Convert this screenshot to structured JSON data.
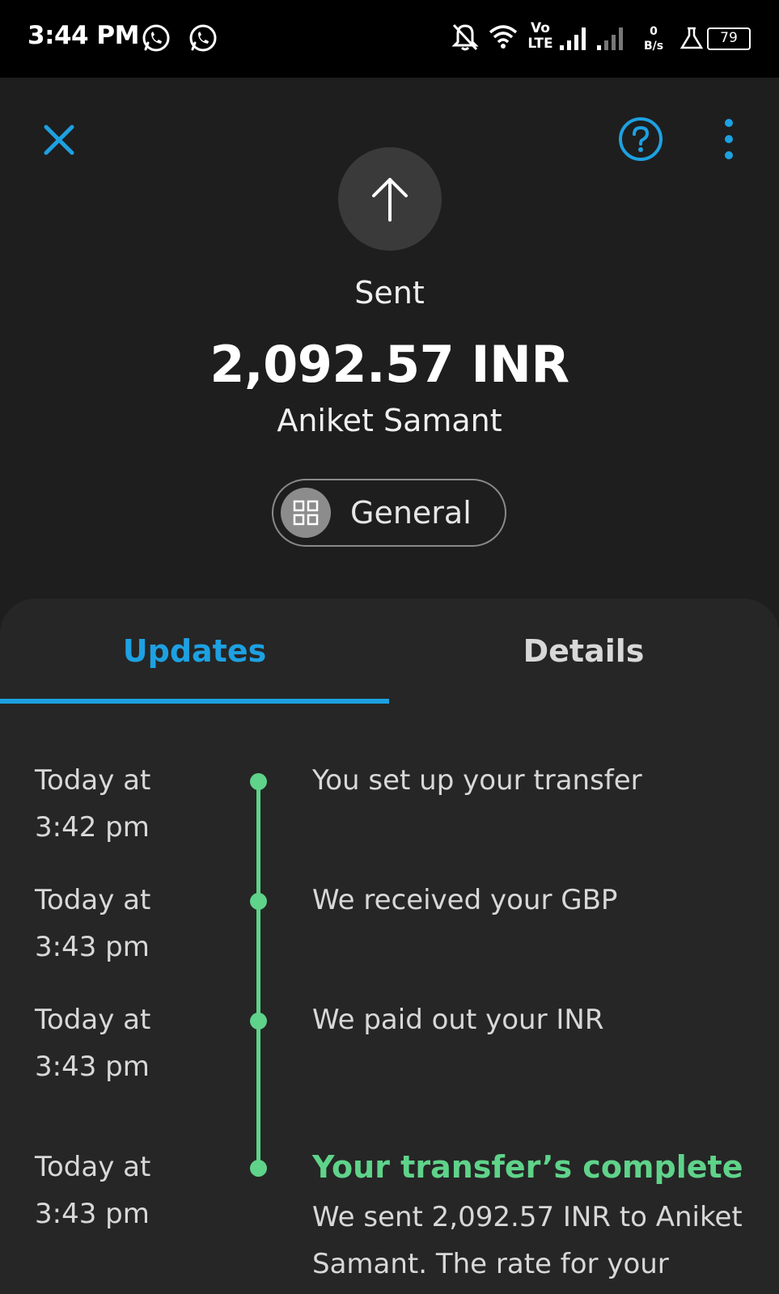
{
  "status_bar": {
    "time": "3:44 PM",
    "icons": [
      "whatsapp-icon",
      "whatsapp-icon",
      "notifications-off-icon",
      "wifi-icon",
      "volte-icon",
      "signal-icon",
      "signal-weak-icon",
      "data-speed-icon",
      "flask-icon",
      "battery-icon"
    ],
    "volte_top": "Vo",
    "volte_bottom": "LTE",
    "data_speed_value": "0",
    "data_speed_unit": "B/s",
    "battery": "79"
  },
  "header": {
    "status": "Sent",
    "amount": "2,092.57 INR",
    "recipient": "Aniket Samant",
    "category": "General",
    "icons": [
      "close-icon",
      "help-icon",
      "more-icon",
      "arrow-up-icon",
      "grid-icon"
    ]
  },
  "tabs": [
    {
      "label": "Updates",
      "active": true
    },
    {
      "label": "Details",
      "active": false
    }
  ],
  "timeline": [
    {
      "time_line1": "Today at",
      "time_line2": "3:42 pm",
      "text": "You set up your transfer"
    },
    {
      "time_line1": "Today at",
      "time_line2": "3:43 pm",
      "text": "We received your GBP"
    },
    {
      "time_line1": "Today at",
      "time_line2": "3:43 pm",
      "text": "We paid out your INR"
    },
    {
      "time_line1": "Today at",
      "time_line2": "3:43 pm",
      "title": "Your transfer’s complete",
      "desc_line1": "We sent 2,092.57 INR to Aniket",
      "desc_line2": "Samant. The rate for your"
    }
  ],
  "colors": {
    "accent": "#1da1e2",
    "success": "#5fd38a",
    "background": "#1e1e1e",
    "panel": "#262626"
  }
}
